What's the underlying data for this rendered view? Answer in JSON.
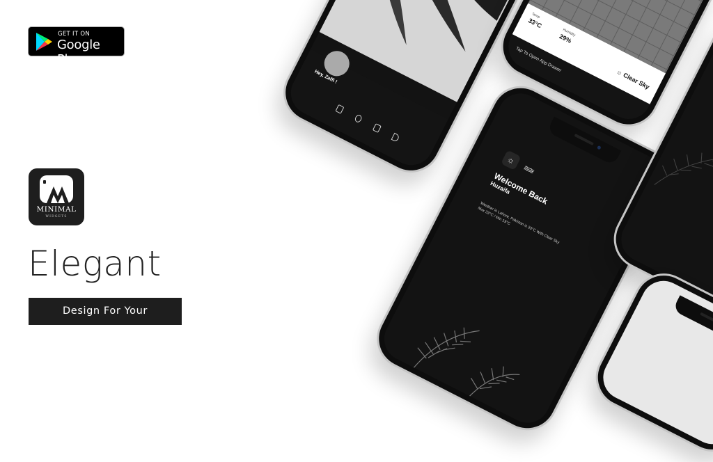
{
  "badge": {
    "small": "GET IT ON",
    "big": "Google Play"
  },
  "app_icon": {
    "name": "MINIMAL",
    "sub": "WIDGETS"
  },
  "headline": "Elegant",
  "cta": "Design For Your Homescreen",
  "phone1": {
    "greeting": "Hey, Zaffi !"
  },
  "phone2": {
    "temp_label": "Temp",
    "temp_value": "33°C",
    "humidity_label": "Humidity",
    "humidity_value": "29%",
    "condition": "Clear Sky",
    "tap_text": "Tap To Open App Drawer",
    "arrow": "↑"
  },
  "phone3": {
    "welcome": "Welcome Back",
    "name": "Huzaifa",
    "weather_text": "Weather in Lahore, Pakistan is 33°C With Clear Sky",
    "minmax": "Max 33°C / Min 19°C"
  },
  "colors": {
    "dark": "#1e1e1e",
    "accent": "#ffffff"
  }
}
